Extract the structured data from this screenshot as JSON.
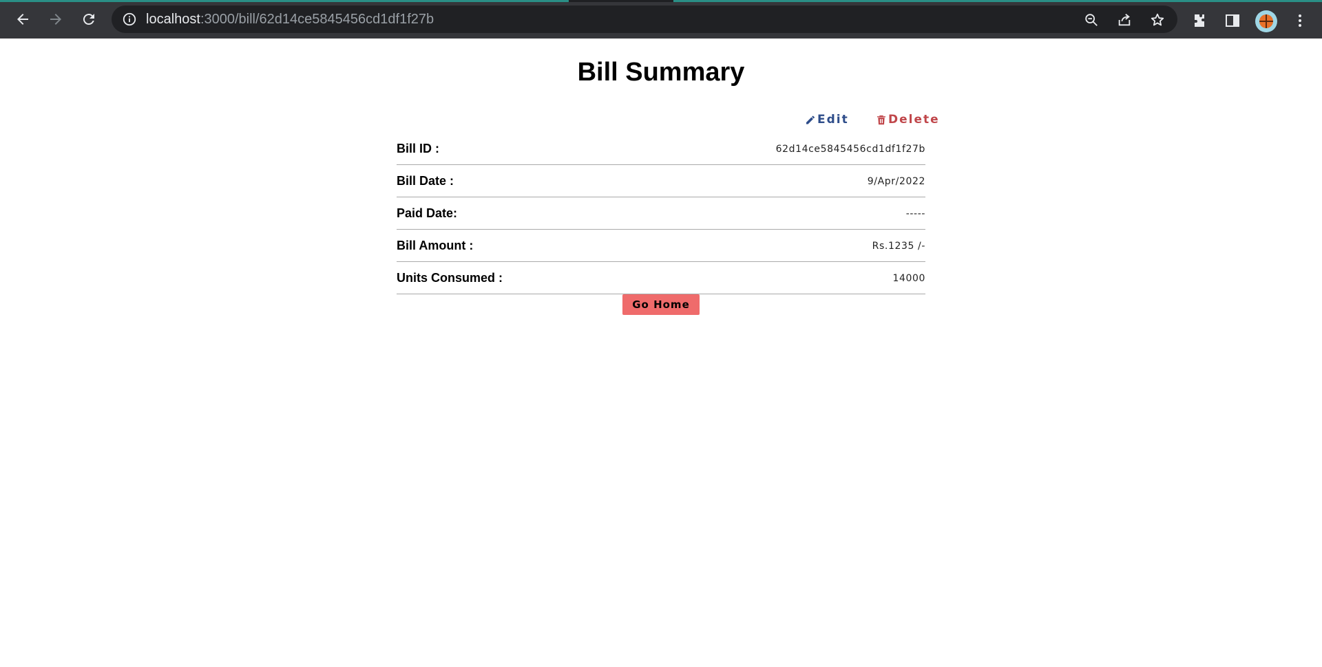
{
  "browser": {
    "url_host": "localhost",
    "url_path": ":3000/bill/62d14ce5845456cd1df1f27b",
    "icons": {
      "back": "back-arrow-icon",
      "forward": "forward-arrow-icon",
      "reload": "reload-icon",
      "info": "info-icon",
      "zoom": "zoom-out-icon",
      "share": "share-icon",
      "bookmark": "star-icon",
      "extensions": "puzzle-icon",
      "sidepanel": "side-panel-icon",
      "menu": "kebab-menu-icon"
    },
    "accent_color": "#2a8f86"
  },
  "page": {
    "title": "Bill Summary",
    "actions": {
      "edit_label": "Edit",
      "delete_label": "Delete",
      "edit_color": "#2e4d8a",
      "delete_color": "#c0464a"
    },
    "details": [
      {
        "label": "Bill ID :",
        "value": "62d14ce5845456cd1df1f27b"
      },
      {
        "label": "Bill Date :",
        "value": "9/Apr/2022"
      },
      {
        "label": "Paid Date:",
        "value": "-----"
      },
      {
        "label": "Bill Amount :",
        "value": "Rs.1235 /-"
      },
      {
        "label": "Units Consumed :",
        "value": "14000"
      }
    ],
    "go_home_label": "Go Home",
    "go_home_color": "#ef6b6b"
  }
}
